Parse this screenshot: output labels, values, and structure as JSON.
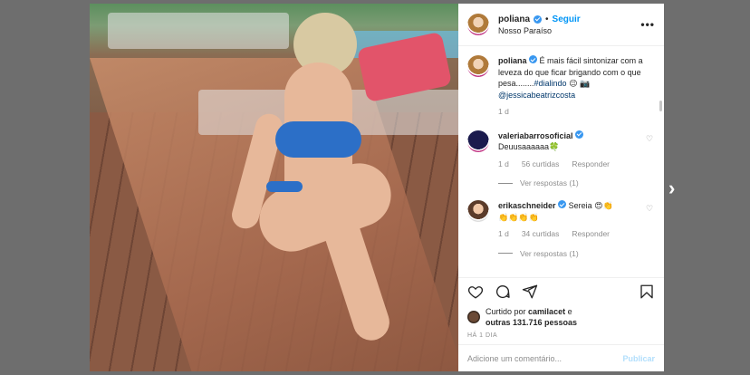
{
  "post": {
    "username": "poliana",
    "follow_label": "Seguir",
    "separator": "•",
    "location": "Nosso Paraíso",
    "more_label": "•••"
  },
  "caption": {
    "username": "poliana",
    "text": "É mais fácil sintonizar com a leveza do que ficar brigando com o que pesa........",
    "hashtag": "#dialindo",
    "emoji": "😉 📷",
    "mention": "@jessicabeatrizcosta",
    "time": "1 d"
  },
  "comments": [
    {
      "username": "valeriabarrosoficial",
      "text": "Deuusaaaaaa🍀",
      "time": "1 d",
      "likes": "56 curtidas",
      "reply": "Responder",
      "view_replies": "Ver respostas (1)"
    },
    {
      "username": "erikaschneider",
      "text": "Sereia 😍👏",
      "emojis": "👏👏👏👏",
      "time": "1 d",
      "likes": "34 curtidas",
      "reply": "Responder",
      "view_replies": "Ver respostas (1)"
    }
  ],
  "likes": {
    "prefix": "Curtido por",
    "user": "camilacet",
    "mid": "e",
    "others": "outras 131.716 pessoas"
  },
  "time_ago": "HÁ 1 DIA",
  "comment_input": {
    "placeholder": "Adicione um comentário...",
    "publish_label": "Publicar"
  },
  "next_arrow": "›",
  "colors": {
    "accent": "#0095f6",
    "verified": "#3897f0",
    "muted": "#8e8e8e",
    "backdrop": "#6e6e6e"
  }
}
